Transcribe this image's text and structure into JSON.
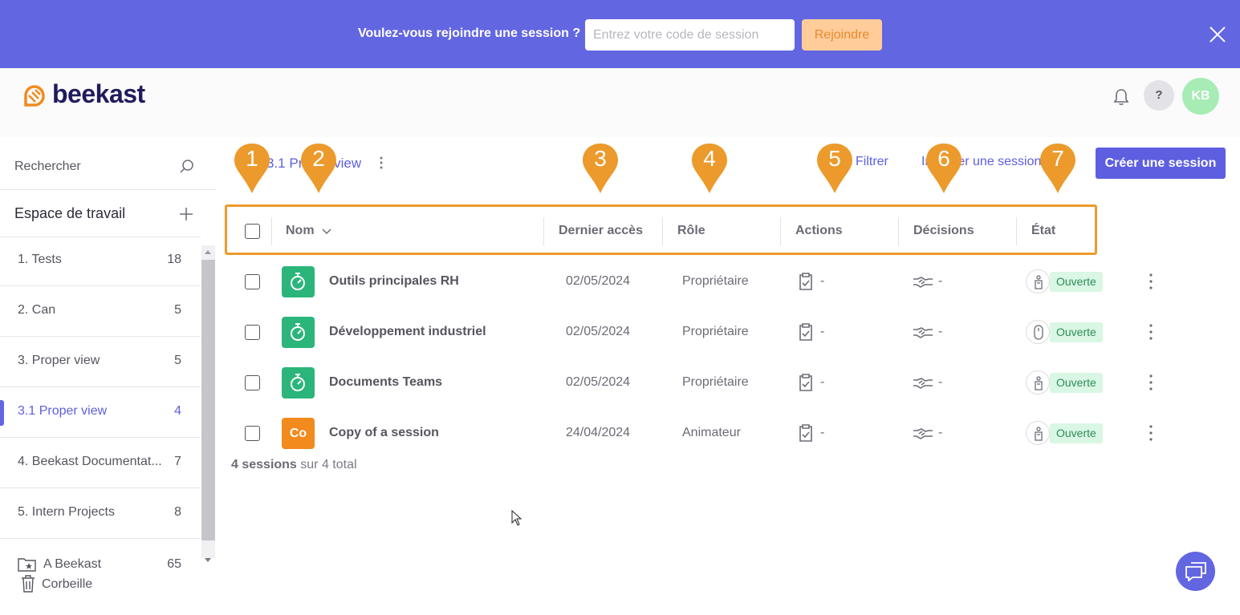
{
  "banner": {
    "question": "Voulez-vous rejoindre une session ?",
    "code_placeholder": "Entrez votre code de session",
    "join_label": "Rejoindre",
    "close_icon": "close-icon",
    "colors": {
      "background": "#6366e1",
      "join_bg": "#ffcc9a",
      "join_text": "#e88a2e"
    }
  },
  "header": {
    "brand": "beekast",
    "help_label": "?",
    "avatar_initials": "KB",
    "icons": [
      "beekast-logo-icon",
      "bell-icon"
    ]
  },
  "sidebar": {
    "search_label": "Rechercher",
    "workspace_title": "Espace de travail",
    "items": [
      {
        "label": "1. Tests",
        "count": "18",
        "active": false
      },
      {
        "label": "2. Can",
        "count": "5",
        "active": false
      },
      {
        "label": "3. Proper view",
        "count": "5",
        "active": false
      },
      {
        "label": "3.1 Proper view",
        "count": "4",
        "active": true
      },
      {
        "label": "4. Beekast Documentat...",
        "count": "7",
        "active": false
      },
      {
        "label": "5. Intern Projects",
        "count": "8",
        "active": false
      }
    ],
    "favorites": {
      "label": "A Beekast",
      "count": "65"
    },
    "trash_label": "Corbeille"
  },
  "toolbar": {
    "breadcrumb": "3.1 Proper view",
    "filter_label": "Filtrer",
    "import_label": "Importer une session",
    "create_label": "Créer une session"
  },
  "table": {
    "columns": [
      "Nom",
      "Dernier accès",
      "Rôle",
      "Actions",
      "Décisions",
      "État"
    ],
    "rows": [
      {
        "name": "Outils principales RH",
        "date": "02/05/2024",
        "role": "Propriétaire",
        "actions": "-",
        "decisions": "-",
        "state": "Ouverte",
        "icon_type": "timer",
        "icon_color": "#2bb57a",
        "icon_text": ""
      },
      {
        "name": "Développement industriel",
        "date": "02/05/2024",
        "role": "Propriétaire",
        "actions": "-",
        "decisions": "-",
        "state": "Ouverte",
        "icon_type": "timer",
        "icon_color": "#2bb57a",
        "icon_text": ""
      },
      {
        "name": "Documents Teams",
        "date": "02/05/2024",
        "role": "Propriétaire",
        "actions": "-",
        "decisions": "-",
        "state": "Ouverte",
        "icon_type": "timer",
        "icon_color": "#2bb57a",
        "icon_text": ""
      },
      {
        "name": "Copy of a session",
        "date": "24/04/2024",
        "role": "Animateur",
        "actions": "-",
        "decisions": "-",
        "state": "Ouverte",
        "icon_type": "text",
        "icon_color": "#f28a1e",
        "icon_text": "Co"
      }
    ],
    "summary_count": "4 sessions",
    "summary_rest": " sur 4 total"
  },
  "markers": [
    "1",
    "2",
    "3",
    "4",
    "5",
    "6",
    "7"
  ],
  "marker_color": "#ec9a2c"
}
